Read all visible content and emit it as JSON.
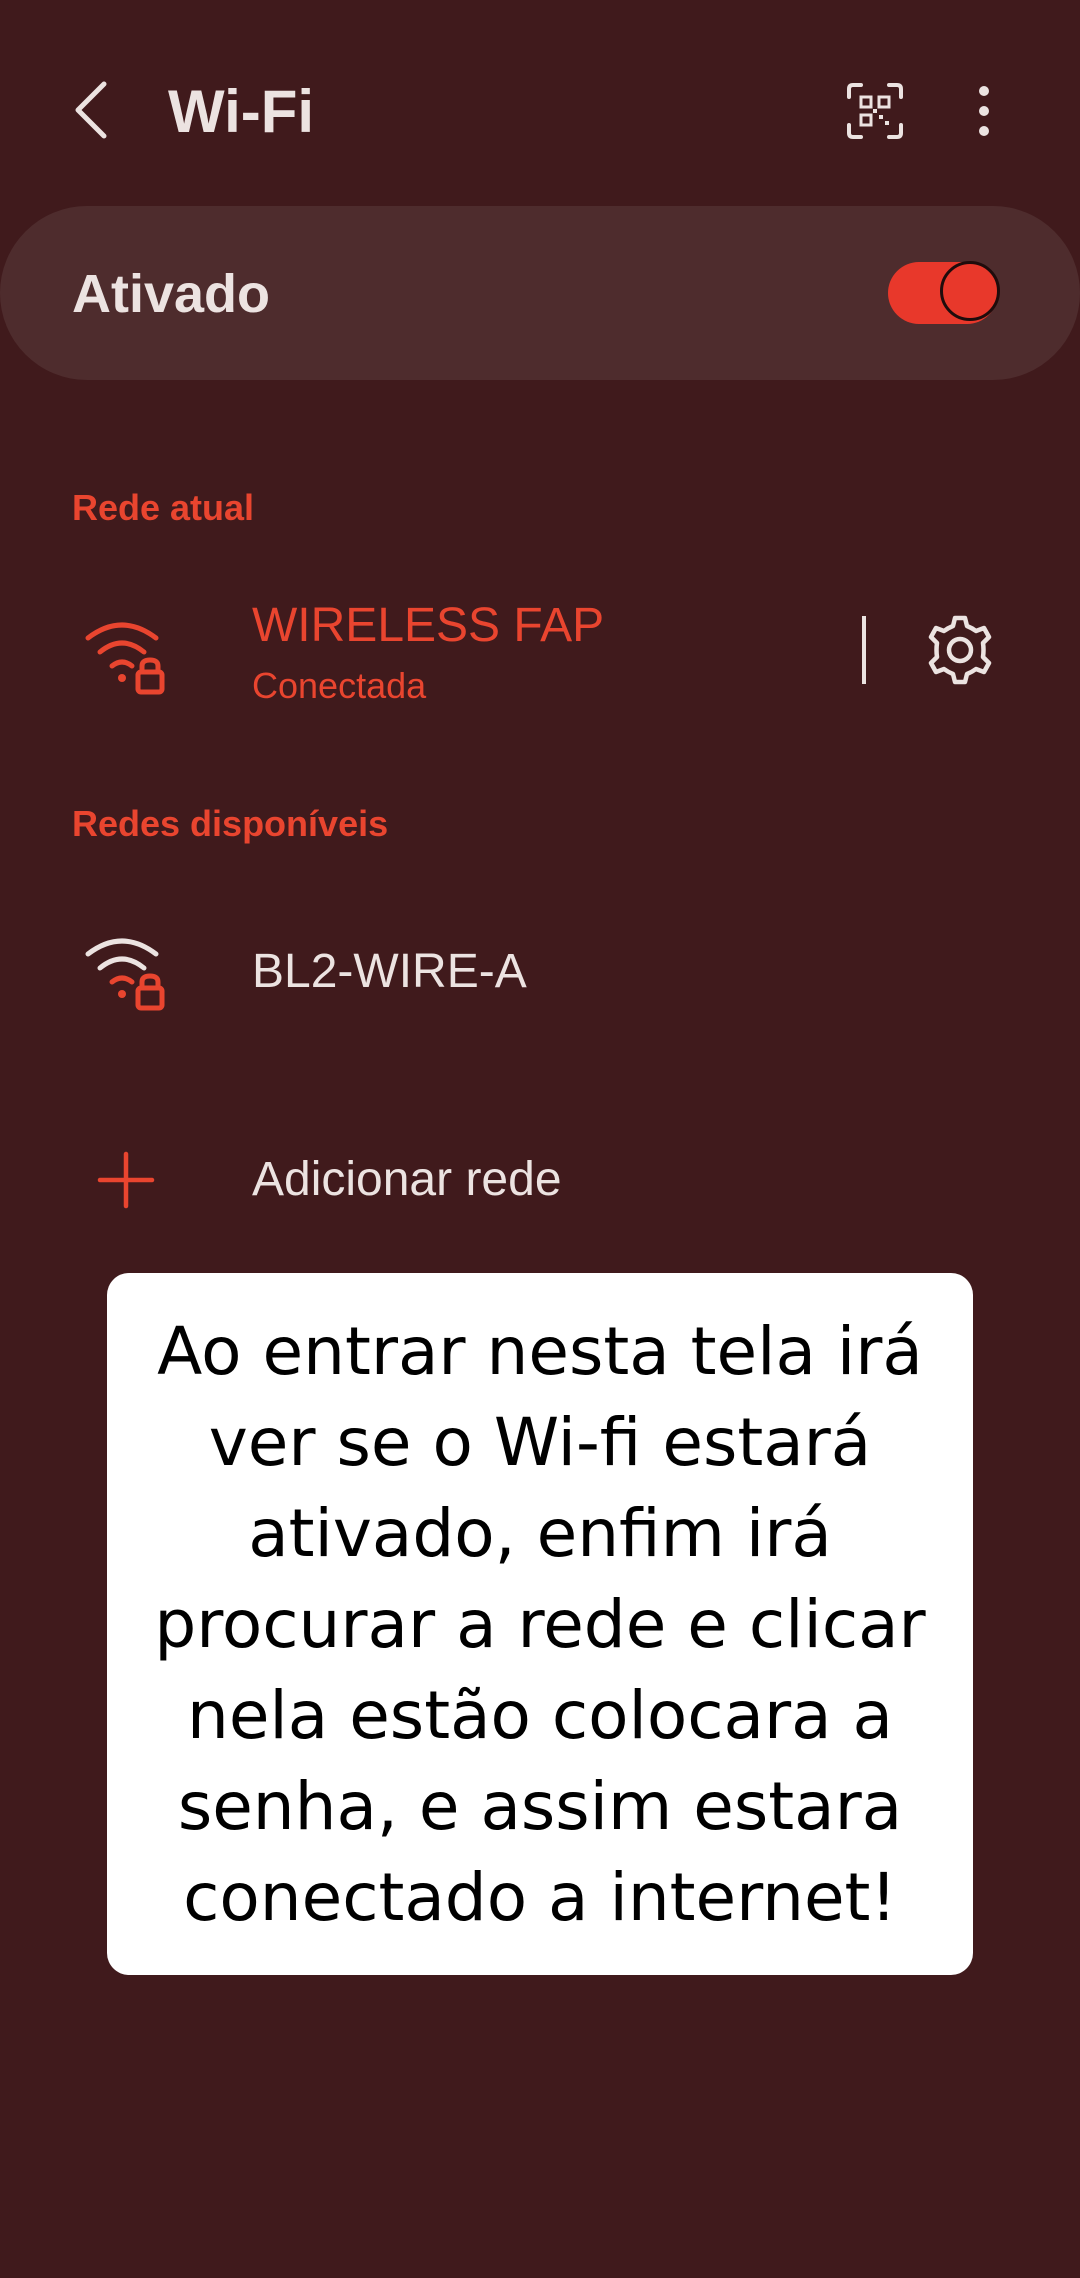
{
  "colors": {
    "background": "#401a1c",
    "card": "#4e2c2d",
    "accent": "#e9452f",
    "text": "#ece3e1",
    "note_background": "#ffffff",
    "note_text": "#000000"
  },
  "header": {
    "title": "Wi-Fi",
    "icons": [
      "back-arrow-icon",
      "qr-code-icon",
      "more-vertical-icon"
    ]
  },
  "wifi_toggle": {
    "label": "Ativado",
    "state": "on"
  },
  "current_network": {
    "section_label": "Rede atual",
    "name": "WIRELESS FAP",
    "status": "Conectada",
    "icon": "wifi-lock-icon",
    "action_icon": "settings-gear-icon"
  },
  "available_networks": {
    "section_label": "Redes disponíveis",
    "items": [
      {
        "name": "BL2-WIRE-A",
        "icon": "wifi-lock-icon"
      }
    ]
  },
  "add_network": {
    "label": "Adicionar rede",
    "icon": "plus-icon"
  },
  "note": {
    "lines": [
      "Ao entrar nesta tela irá",
      "ver se o Wi-fi estará",
      "ativado, enfim irá",
      "procurar a rede e clicar",
      "nela estão colocara a",
      "senha, e assim estara",
      "conectado a internet!"
    ]
  }
}
